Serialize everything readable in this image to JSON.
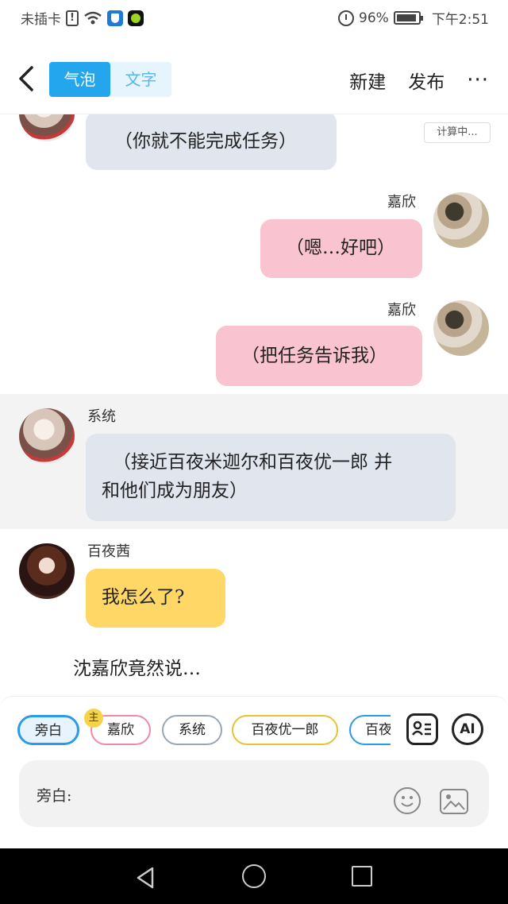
{
  "status_bar": {
    "carrier": "未插卡",
    "battery": "96%",
    "time": "下午2:51",
    "icons": [
      "alert-icon",
      "wifi-icon",
      "shield-icon",
      "app-icon",
      "alarm-icon",
      "battery-icon"
    ]
  },
  "topbar": {
    "modes": [
      {
        "label": "气泡",
        "active": true
      },
      {
        "label": "文字",
        "active": false
      }
    ],
    "new_label": "新建",
    "publish_label": "发布",
    "more_label": "···"
  },
  "chat": {
    "calc_badge": "计算中...",
    "messages": [
      {
        "speaker": "",
        "side": "left",
        "text": "（你就不能完成任务）",
        "color": "#e1e6ee"
      },
      {
        "speaker": "嘉欣",
        "side": "right",
        "text": "（嗯…好吧）",
        "color": "#f9c4cf"
      },
      {
        "speaker": "嘉欣",
        "side": "right",
        "text": "（把任务告诉我）",
        "color": "#f9c4cf"
      },
      {
        "speaker": "系统",
        "side": "left",
        "text_lines": [
          "（接近百夜米迦尔和百夜优一郎 并",
          "和他们成为朋友）"
        ],
        "color": "#e1e6ee"
      },
      {
        "speaker": "百夜茜",
        "side": "left",
        "text": "我怎么了?",
        "color": "#ffd766"
      }
    ],
    "narration": "沈嘉欣竟然说…"
  },
  "roles": {
    "chips": [
      {
        "label": "旁白",
        "color": "#2a9be8",
        "active": true
      },
      {
        "label": "嘉欣",
        "color": "#ee8aa6",
        "active": false
      },
      {
        "label": "系统",
        "color": "#9aa6b4",
        "active": false
      },
      {
        "label": "百夜优一郎",
        "color": "#e8c232",
        "active": false
      },
      {
        "label": "百夜",
        "color": "#2a9be8",
        "active": false
      }
    ],
    "main_badge": "主",
    "ai_label": "AI"
  },
  "input": {
    "label": "旁白:"
  }
}
